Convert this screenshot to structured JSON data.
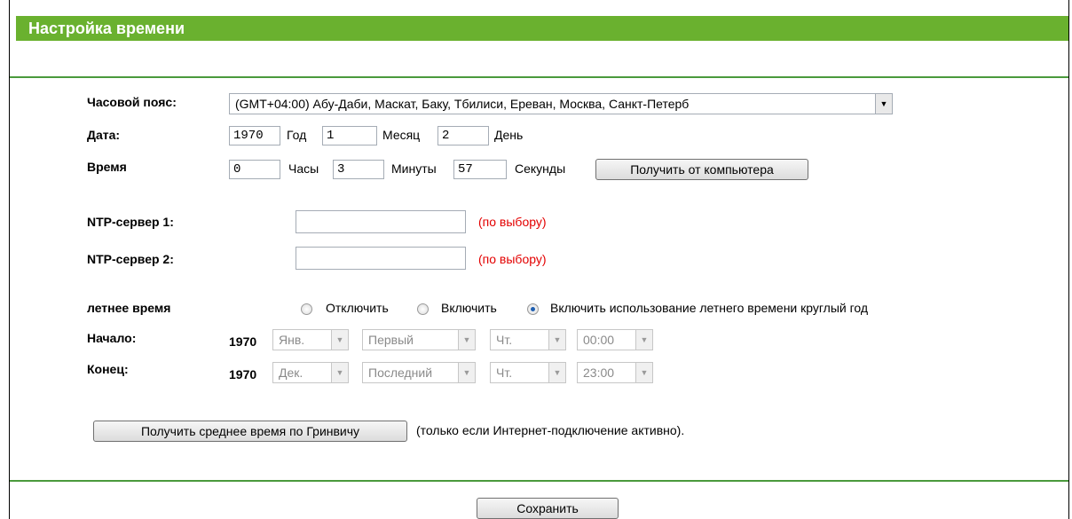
{
  "section_title": "Настройка времени",
  "timezone": {
    "label": "Часовой пояс:",
    "value": "(GMT+04:00) Абу-Даби,  Маскат, Баку, Тбилиси, Ереван, Москва, Санкт-Петерб"
  },
  "date": {
    "label": "Дата:",
    "year": "1970",
    "year_unit": "Год",
    "month": "1",
    "month_unit": "Месяц",
    "day": "2",
    "day_unit": "День"
  },
  "time": {
    "label": "Время",
    "hours": "0",
    "hours_unit": "Часы",
    "minutes": "3",
    "minutes_unit": "Минуты",
    "seconds": "57",
    "seconds_unit": "Секунды",
    "get_from_pc_label": "Получить от компьютера"
  },
  "ntp": {
    "server1_label": "NTP-сервер 1:",
    "server1_value": "",
    "server2_label": "NTP-сервер 2:",
    "server2_value": "",
    "optional_hint": "(по выбору)"
  },
  "dst": {
    "label": "летнее время",
    "options": [
      "Отключить",
      "Включить",
      "Включить использование летнего времени круглый год"
    ],
    "selected_index": 2,
    "start_label": "Начало:",
    "end_label": "Конец:",
    "start": {
      "year": "1970",
      "month": "Янв.",
      "week": "Первый",
      "weekday": "Чт.",
      "time": "00:00"
    },
    "end": {
      "year": "1970",
      "month": "Дек.",
      "week": "Последний",
      "weekday": "Чт.",
      "time": "23:00"
    }
  },
  "gmt": {
    "button_label": "Получить среднее время по Гринвичу",
    "note": "(только если Интернет-подключение активно)."
  },
  "save_label": "Сохранить",
  "colors": {
    "accent": "#6ab12f",
    "divider": "#4a9a3c",
    "hint": "#e30000"
  }
}
